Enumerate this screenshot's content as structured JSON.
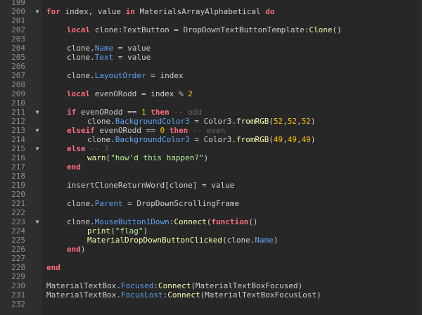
{
  "editor": {
    "lines": [
      {
        "n": "199",
        "fold": "",
        "indent": 0,
        "tokens": []
      },
      {
        "n": "200",
        "fold": "▼",
        "indent": 0,
        "tokens": [
          {
            "t": "for",
            "c": "kw"
          },
          {
            "t": " index, value ",
            "c": "id"
          },
          {
            "t": "in",
            "c": "kw"
          },
          {
            "t": " MaterialsArrayAlphabetical ",
            "c": "id"
          },
          {
            "t": "do",
            "c": "kw"
          }
        ]
      },
      {
        "n": "201",
        "fold": "",
        "indent": 0,
        "tokens": []
      },
      {
        "n": "202",
        "fold": "",
        "indent": 1,
        "tokens": [
          {
            "t": "local",
            "c": "kw"
          },
          {
            "t": " clone:TextButton = DropDownTextButtonTemplate:",
            "c": "id"
          },
          {
            "t": "Clone",
            "c": "fn"
          },
          {
            "t": "()",
            "c": "op"
          }
        ]
      },
      {
        "n": "203",
        "fold": "",
        "indent": 0,
        "tokens": []
      },
      {
        "n": "204",
        "fold": "",
        "indent": 1,
        "tokens": [
          {
            "t": "clone.",
            "c": "id"
          },
          {
            "t": "Name",
            "c": "prop"
          },
          {
            "t": " = value",
            "c": "id"
          }
        ]
      },
      {
        "n": "205",
        "fold": "",
        "indent": 1,
        "tokens": [
          {
            "t": "clone.",
            "c": "id"
          },
          {
            "t": "Text",
            "c": "prop"
          },
          {
            "t": " = value",
            "c": "id"
          }
        ]
      },
      {
        "n": "206",
        "fold": "",
        "indent": 0,
        "tokens": []
      },
      {
        "n": "207",
        "fold": "",
        "indent": 1,
        "tokens": [
          {
            "t": "clone.",
            "c": "id"
          },
          {
            "t": "LayoutOrder",
            "c": "prop"
          },
          {
            "t": " = index",
            "c": "id"
          }
        ]
      },
      {
        "n": "208",
        "fold": "",
        "indent": 0,
        "tokens": []
      },
      {
        "n": "209",
        "fold": "",
        "indent": 1,
        "tokens": [
          {
            "t": "local",
            "c": "kw"
          },
          {
            "t": " evenORodd = index % ",
            "c": "id"
          },
          {
            "t": "2",
            "c": "num"
          }
        ]
      },
      {
        "n": "210",
        "fold": "",
        "indent": 0,
        "tokens": []
      },
      {
        "n": "211",
        "fold": "▼",
        "indent": 1,
        "tokens": [
          {
            "t": "if",
            "c": "kw"
          },
          {
            "t": " evenORodd == ",
            "c": "id"
          },
          {
            "t": "1",
            "c": "num"
          },
          {
            "t": " ",
            "c": "id"
          },
          {
            "t": "then",
            "c": "kw"
          },
          {
            "t": " -- odd",
            "c": "cm"
          }
        ]
      },
      {
        "n": "212",
        "fold": "",
        "indent": 2,
        "tokens": [
          {
            "t": "clone.",
            "c": "id"
          },
          {
            "t": "BackgroundColor3",
            "c": "prop"
          },
          {
            "t": " = Color3.",
            "c": "id"
          },
          {
            "t": "fromRGB",
            "c": "fn"
          },
          {
            "t": "(",
            "c": "op"
          },
          {
            "t": "52",
            "c": "num"
          },
          {
            "t": ",",
            "c": "op"
          },
          {
            "t": "52",
            "c": "num"
          },
          {
            "t": ",",
            "c": "op"
          },
          {
            "t": "52",
            "c": "num"
          },
          {
            "t": ")",
            "c": "op"
          }
        ]
      },
      {
        "n": "213",
        "fold": "▼",
        "indent": 1,
        "tokens": [
          {
            "t": "elseif",
            "c": "kw"
          },
          {
            "t": " evenORodd == ",
            "c": "id"
          },
          {
            "t": "0",
            "c": "num"
          },
          {
            "t": " ",
            "c": "id"
          },
          {
            "t": "then",
            "c": "kw"
          },
          {
            "t": " -- even",
            "c": "cm"
          }
        ]
      },
      {
        "n": "214",
        "fold": "",
        "indent": 2,
        "tokens": [
          {
            "t": "clone.",
            "c": "id"
          },
          {
            "t": "BackgroundColor3",
            "c": "prop"
          },
          {
            "t": " = Color3.",
            "c": "id"
          },
          {
            "t": "fromRGB",
            "c": "fn"
          },
          {
            "t": "(",
            "c": "op"
          },
          {
            "t": "49",
            "c": "num"
          },
          {
            "t": ",",
            "c": "op"
          },
          {
            "t": "49",
            "c": "num"
          },
          {
            "t": ",",
            "c": "op"
          },
          {
            "t": "49",
            "c": "num"
          },
          {
            "t": ")",
            "c": "op"
          }
        ]
      },
      {
        "n": "215",
        "fold": "▼",
        "indent": 1,
        "tokens": [
          {
            "t": "else",
            "c": "kw"
          },
          {
            "t": " -- ?",
            "c": "cm"
          }
        ]
      },
      {
        "n": "216",
        "fold": "",
        "indent": 2,
        "tokens": [
          {
            "t": "warn",
            "c": "fn"
          },
          {
            "t": "(",
            "c": "op"
          },
          {
            "t": "\"how'd this happen?\"",
            "c": "str"
          },
          {
            "t": ")",
            "c": "op"
          }
        ]
      },
      {
        "n": "217",
        "fold": "",
        "indent": 1,
        "tokens": [
          {
            "t": "end",
            "c": "kw"
          }
        ]
      },
      {
        "n": "218",
        "fold": "",
        "indent": 0,
        "tokens": []
      },
      {
        "n": "219",
        "fold": "",
        "indent": 1,
        "tokens": [
          {
            "t": "insertCloneReturnWord[clone] = value",
            "c": "id"
          }
        ]
      },
      {
        "n": "220",
        "fold": "",
        "indent": 0,
        "tokens": []
      },
      {
        "n": "221",
        "fold": "",
        "indent": 1,
        "tokens": [
          {
            "t": "clone.",
            "c": "id"
          },
          {
            "t": "Parent",
            "c": "prop"
          },
          {
            "t": " = DropDownScrollingFrame",
            "c": "id"
          }
        ]
      },
      {
        "n": "222",
        "fold": "",
        "indent": 0,
        "tokens": []
      },
      {
        "n": "223",
        "fold": "▼",
        "indent": 1,
        "tokens": [
          {
            "t": "clone.",
            "c": "id"
          },
          {
            "t": "MouseButton1Down",
            "c": "prop"
          },
          {
            "t": ":",
            "c": "id"
          },
          {
            "t": "Connect",
            "c": "fn"
          },
          {
            "t": "(",
            "c": "op"
          },
          {
            "t": "function",
            "c": "kw"
          },
          {
            "t": "()",
            "c": "op"
          }
        ]
      },
      {
        "n": "224",
        "fold": "",
        "indent": 2,
        "tokens": [
          {
            "t": "print",
            "c": "fn"
          },
          {
            "t": "(",
            "c": "op"
          },
          {
            "t": "\"flag\"",
            "c": "str"
          },
          {
            "t": ")",
            "c": "op"
          }
        ]
      },
      {
        "n": "225",
        "fold": "",
        "indent": 2,
        "tokens": [
          {
            "t": "MaterialDropDownButtonClicked",
            "c": "fn"
          },
          {
            "t": "(clone.",
            "c": "op"
          },
          {
            "t": "Name",
            "c": "prop"
          },
          {
            "t": ")",
            "c": "op"
          }
        ]
      },
      {
        "n": "226",
        "fold": "",
        "indent": 1,
        "tokens": [
          {
            "t": "end",
            "c": "kw"
          },
          {
            "t": ")",
            "c": "op"
          }
        ]
      },
      {
        "n": "227",
        "fold": "",
        "indent": 0,
        "tokens": []
      },
      {
        "n": "228",
        "fold": "",
        "indent": 0,
        "tokens": [
          {
            "t": "end",
            "c": "kw"
          }
        ]
      },
      {
        "n": "229",
        "fold": "",
        "indent": 0,
        "tokens": []
      },
      {
        "n": "230",
        "fold": "",
        "indent": 0,
        "tokens": [
          {
            "t": "MaterialTextBox.",
            "c": "id"
          },
          {
            "t": "Focused",
            "c": "prop"
          },
          {
            "t": ":",
            "c": "id"
          },
          {
            "t": "Connect",
            "c": "fn"
          },
          {
            "t": "(MaterialTextBoxFocused)",
            "c": "op"
          }
        ]
      },
      {
        "n": "231",
        "fold": "",
        "indent": 0,
        "tokens": [
          {
            "t": "MaterialTextBox.",
            "c": "id"
          },
          {
            "t": "FocusLost",
            "c": "prop"
          },
          {
            "t": ":",
            "c": "id"
          },
          {
            "t": "Connect",
            "c": "fn"
          },
          {
            "t": "(MaterialTextBoxFocusLost)",
            "c": "op"
          }
        ]
      },
      {
        "n": "232",
        "fold": "",
        "indent": 0,
        "tokens": []
      }
    ]
  }
}
